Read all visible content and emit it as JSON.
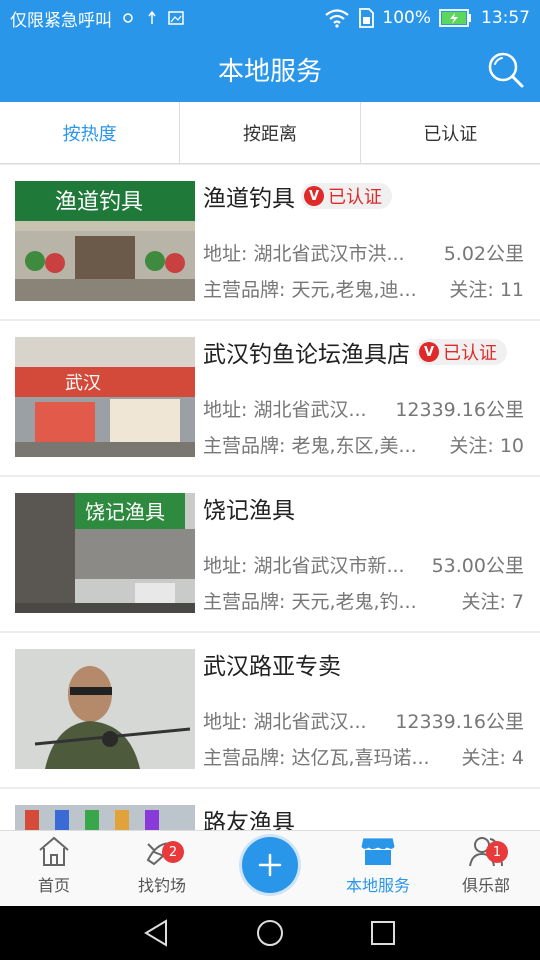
{
  "status_bar": {
    "carrier_text": "仅限紧急呼叫",
    "battery": "100%",
    "time": "13:57"
  },
  "header": {
    "title": "本地服务"
  },
  "tabs": [
    {
      "label": "按热度"
    },
    {
      "label": "按距离"
    },
    {
      "label": "已认证"
    }
  ],
  "shops": [
    {
      "name": "渔道钓具",
      "verified": "已认证",
      "address": "地址: 湖北省武汉市洪...",
      "distance": "5.02公里",
      "brands": "主营品牌: 天元,老鬼,迪...",
      "follows": "关注: 11"
    },
    {
      "name": "武汉钓鱼论坛渔具店",
      "verified": "已认证",
      "address": "地址: 湖北省武汉...",
      "distance": "12339.16公里",
      "brands": "主营品牌: 老鬼,东区,美...",
      "follows": "关注: 10"
    },
    {
      "name": "饶记渔具",
      "address": "地址: 湖北省武汉市新...",
      "distance": "53.00公里",
      "brands": "主营品牌: 天元,老鬼,钓...",
      "follows": "关注: 7"
    },
    {
      "name": "武汉路亚专卖",
      "address": "地址: 湖北省武汉...",
      "distance": "12339.16公里",
      "brands": "主营品牌: 达亿瓦,喜玛诺...",
      "follows": "关注: 4"
    },
    {
      "name": "路友渔具"
    }
  ],
  "image_signs": {
    "shop1": "渔道钓具",
    "shop2": "武汉",
    "shop3": "饶记渔具"
  },
  "bottom_nav": {
    "home": "首页",
    "fishing_spot": "找钓场",
    "fishing_spot_badge": "2",
    "local_service": "本地服务",
    "club": "俱乐部",
    "club_badge": "1"
  },
  "colors": {
    "primary": "#2a96ea",
    "verified_red": "#e02a2a",
    "badge_red": "#e8393b"
  }
}
